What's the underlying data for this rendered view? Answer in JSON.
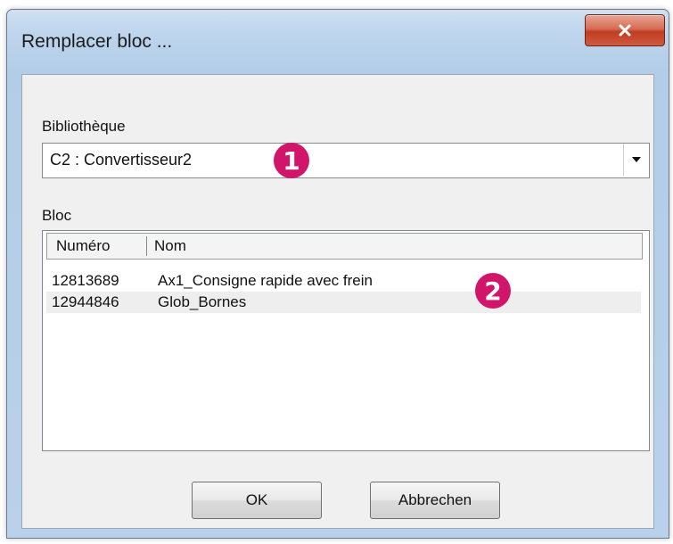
{
  "window": {
    "title": "Remplacer bloc ..."
  },
  "library": {
    "label": "Bibliothèque",
    "selected": "C2 : Convertisseur2"
  },
  "block": {
    "label": "Bloc",
    "columns": [
      "Numéro",
      "Nom"
    ],
    "rows": [
      {
        "number": "12813689",
        "name": "Ax1_Consigne rapide avec frein"
      },
      {
        "number": "12944846",
        "name": "Glob_Bornes"
      }
    ]
  },
  "buttons": {
    "ok": "OK",
    "cancel": "Abbrechen"
  },
  "callouts": [
    "1",
    "2"
  ],
  "colors": {
    "callout": "#d1156b",
    "close": "#c03c22"
  }
}
